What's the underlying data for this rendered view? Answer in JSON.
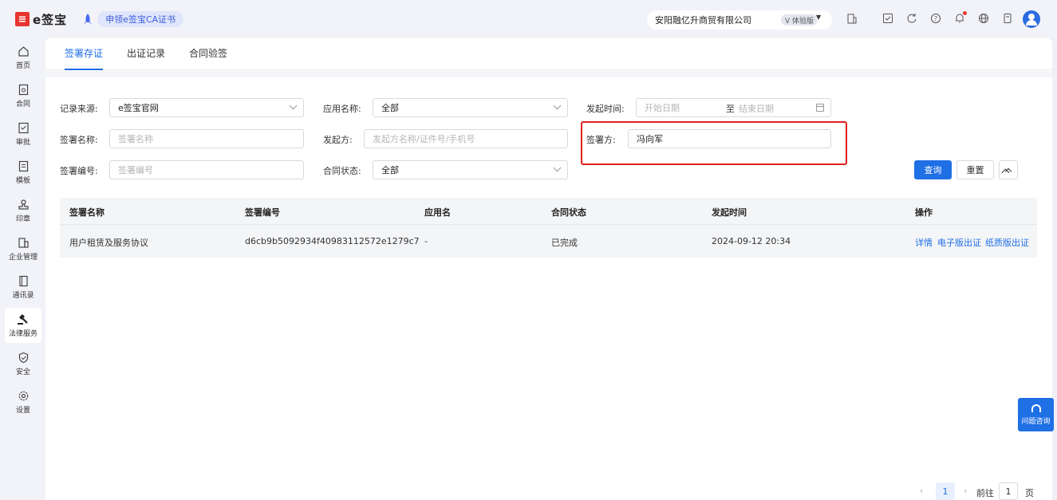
{
  "header": {
    "logo_mark": "e",
    "logo_text": "e签宝",
    "ca_label": "申领e签宝CA证书",
    "company": "安阳融亿升商贸有限公司",
    "edition_tag": "V 体验版"
  },
  "sidebar": {
    "items": [
      {
        "label": "首页",
        "icon": "home-icon"
      },
      {
        "label": "合同",
        "icon": "contract-icon"
      },
      {
        "label": "审批",
        "icon": "approval-icon"
      },
      {
        "label": "模板",
        "icon": "template-icon"
      },
      {
        "label": "印章",
        "icon": "seal-icon"
      },
      {
        "label": "企业管理",
        "icon": "enterprise-icon"
      },
      {
        "label": "通讯录",
        "icon": "contacts-icon"
      },
      {
        "label": "法律服务",
        "icon": "gavel-icon"
      },
      {
        "label": "安全",
        "icon": "shield-icon"
      },
      {
        "label": "设置",
        "icon": "gear-icon"
      }
    ]
  },
  "tabs": [
    "签署存证",
    "出证记录",
    "合同验签"
  ],
  "filters": {
    "source_label": "记录来源:",
    "source_value": "e签宝官网",
    "app_label": "应用名称:",
    "app_value": "全部",
    "time_label": "发起时间:",
    "start_placeholder": "开始日期",
    "date_sep": "至",
    "end_placeholder": "结束日期",
    "sign_name_label": "签署名称:",
    "sign_name_placeholder": "签署名称",
    "initiator_label": "发起方:",
    "initiator_placeholder": "发起方名称/证件号/手机号",
    "signer_label": "签署方:",
    "signer_value": "冯向军",
    "sign_no_label": "签署编号:",
    "sign_no_placeholder": "签署编号",
    "status_label": "合同状态:",
    "status_value": "全部",
    "query_button": "查询",
    "reset_button": "重置"
  },
  "table": {
    "columns": [
      "签署名称",
      "签署编号",
      "应用名",
      "合同状态",
      "发起时间",
      "操作"
    ],
    "rows": [
      {
        "name": "用户租赁及服务协议",
        "number": "d6cb9b5092934f40983112572e1279c7",
        "app": "-",
        "status": "已完成",
        "time": "2024-09-12 20:34",
        "actions": [
          "详情",
          "电子版出证",
          "纸质版出证"
        ]
      }
    ]
  },
  "pagination": {
    "current_page": "1",
    "goto_label": "前往",
    "goto_value": "1",
    "page_unit": "页"
  },
  "help": {
    "label": "问题咨询"
  }
}
